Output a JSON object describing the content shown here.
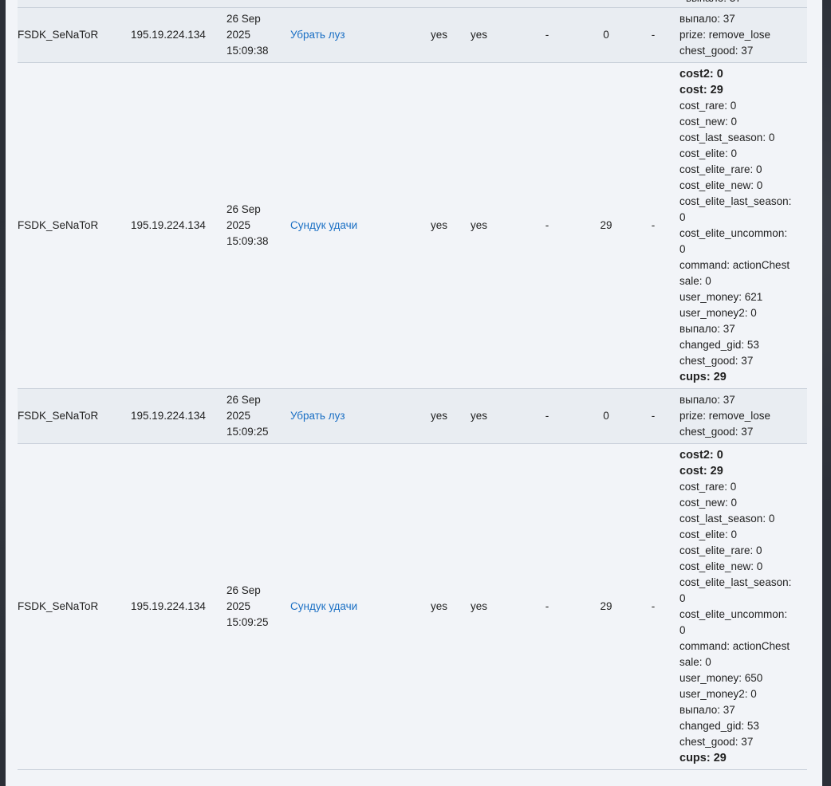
{
  "top_partial": "выпало: 37",
  "rows": [
    {
      "user": "FSDK_SeNaToR",
      "ip": "195.19.224.134",
      "date_lines": [
        "26 Sep",
        "2025",
        "15:09:38"
      ],
      "action": "Убрать луз",
      "flag1": "yes",
      "flag2": "yes",
      "col_a": "-",
      "amount": "0",
      "col_b": "-",
      "details": [
        {
          "text": "выпало: 37",
          "bold": false
        },
        {
          "text": "prize: remove_lose",
          "bold": false
        },
        {
          "text": "chest_good: 37",
          "bold": false
        }
      ]
    },
    {
      "user": "FSDK_SeNaToR",
      "ip": "195.19.224.134",
      "date_lines": [
        "26 Sep",
        "2025",
        "15:09:38"
      ],
      "action": "Сундук удачи",
      "flag1": "yes",
      "flag2": "yes",
      "col_a": "-",
      "amount": "29",
      "col_b": "-",
      "details": [
        {
          "text": "cost2: 0",
          "bold": true
        },
        {
          "text": "cost: 29",
          "bold": true
        },
        {
          "text": "cost_rare: 0",
          "bold": false
        },
        {
          "text": "cost_new: 0",
          "bold": false
        },
        {
          "text": "cost_last_season: 0",
          "bold": false
        },
        {
          "text": "cost_elite: 0",
          "bold": false
        },
        {
          "text": "cost_elite_rare: 0",
          "bold": false
        },
        {
          "text": "cost_elite_new: 0",
          "bold": false
        },
        {
          "text": "cost_elite_last_season:",
          "bold": false
        },
        {
          "text": "0",
          "bold": false
        },
        {
          "text": "cost_elite_uncommon:",
          "bold": false
        },
        {
          "text": "0",
          "bold": false
        },
        {
          "text": "command: actionChest",
          "bold": false
        },
        {
          "text": "sale: 0",
          "bold": false
        },
        {
          "text": "user_money: 621",
          "bold": false
        },
        {
          "text": "user_money2: 0",
          "bold": false
        },
        {
          "text": "выпало: 37",
          "bold": false
        },
        {
          "text": "changed_gid: 53",
          "bold": false
        },
        {
          "text": "chest_good: 37",
          "bold": false
        },
        {
          "text": "cups: 29",
          "bold": true
        }
      ]
    },
    {
      "user": "FSDK_SeNaToR",
      "ip": "195.19.224.134",
      "date_lines": [
        "26 Sep",
        "2025",
        "15:09:25"
      ],
      "action": "Убрать луз",
      "flag1": "yes",
      "flag2": "yes",
      "col_a": "-",
      "amount": "0",
      "col_b": "-",
      "details": [
        {
          "text": "выпало: 37",
          "bold": false
        },
        {
          "text": "prize: remove_lose",
          "bold": false
        },
        {
          "text": "chest_good: 37",
          "bold": false
        }
      ]
    },
    {
      "user": "FSDK_SeNaToR",
      "ip": "195.19.224.134",
      "date_lines": [
        "26 Sep",
        "2025",
        "15:09:25"
      ],
      "action": "Сундук удачи",
      "flag1": "yes",
      "flag2": "yes",
      "col_a": "-",
      "amount": "29",
      "col_b": "-",
      "details": [
        {
          "text": "cost2: 0",
          "bold": true
        },
        {
          "text": "cost: 29",
          "bold": true
        },
        {
          "text": "cost_rare: 0",
          "bold": false
        },
        {
          "text": "cost_new: 0",
          "bold": false
        },
        {
          "text": "cost_last_season: 0",
          "bold": false
        },
        {
          "text": "cost_elite: 0",
          "bold": false
        },
        {
          "text": "cost_elite_rare: 0",
          "bold": false
        },
        {
          "text": "cost_elite_new: 0",
          "bold": false
        },
        {
          "text": "cost_elite_last_season:",
          "bold": false
        },
        {
          "text": "0",
          "bold": false
        },
        {
          "text": "cost_elite_uncommon:",
          "bold": false
        },
        {
          "text": "0",
          "bold": false
        },
        {
          "text": "command: actionChest",
          "bold": false
        },
        {
          "text": "sale: 0",
          "bold": false
        },
        {
          "text": "user_money: 650",
          "bold": false
        },
        {
          "text": "user_money2: 0",
          "bold": false
        },
        {
          "text": "выпало: 37",
          "bold": false
        },
        {
          "text": "changed_gid: 53",
          "bold": false
        },
        {
          "text": "chest_good: 37",
          "bold": false
        },
        {
          "text": "cups: 29",
          "bold": true
        }
      ]
    }
  ]
}
